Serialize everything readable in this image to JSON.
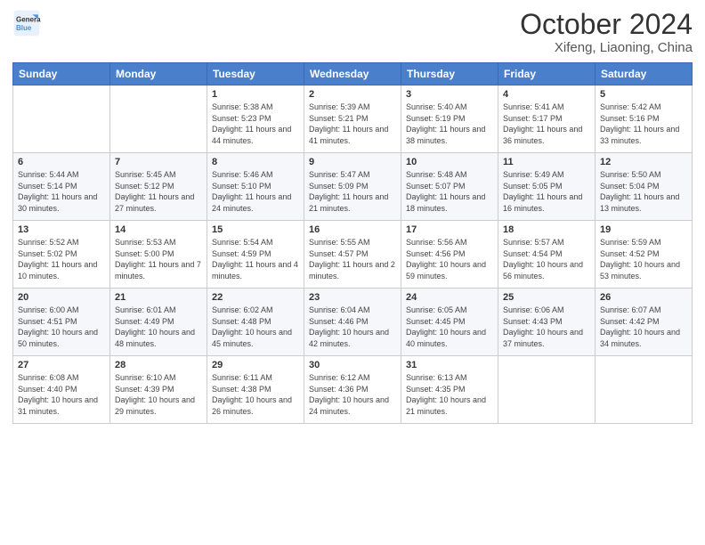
{
  "logo": {
    "line1": "General",
    "line2": "Blue"
  },
  "title": "October 2024",
  "subtitle": "Xifeng, Liaoning, China",
  "days_of_week": [
    "Sunday",
    "Monday",
    "Tuesday",
    "Wednesday",
    "Thursday",
    "Friday",
    "Saturday"
  ],
  "weeks": [
    [
      {
        "day": "",
        "sunrise": "",
        "sunset": "",
        "daylight": ""
      },
      {
        "day": "",
        "sunrise": "",
        "sunset": "",
        "daylight": ""
      },
      {
        "day": "1",
        "sunrise": "Sunrise: 5:38 AM",
        "sunset": "Sunset: 5:23 PM",
        "daylight": "Daylight: 11 hours and 44 minutes."
      },
      {
        "day": "2",
        "sunrise": "Sunrise: 5:39 AM",
        "sunset": "Sunset: 5:21 PM",
        "daylight": "Daylight: 11 hours and 41 minutes."
      },
      {
        "day": "3",
        "sunrise": "Sunrise: 5:40 AM",
        "sunset": "Sunset: 5:19 PM",
        "daylight": "Daylight: 11 hours and 38 minutes."
      },
      {
        "day": "4",
        "sunrise": "Sunrise: 5:41 AM",
        "sunset": "Sunset: 5:17 PM",
        "daylight": "Daylight: 11 hours and 36 minutes."
      },
      {
        "day": "5",
        "sunrise": "Sunrise: 5:42 AM",
        "sunset": "Sunset: 5:16 PM",
        "daylight": "Daylight: 11 hours and 33 minutes."
      }
    ],
    [
      {
        "day": "6",
        "sunrise": "Sunrise: 5:44 AM",
        "sunset": "Sunset: 5:14 PM",
        "daylight": "Daylight: 11 hours and 30 minutes."
      },
      {
        "day": "7",
        "sunrise": "Sunrise: 5:45 AM",
        "sunset": "Sunset: 5:12 PM",
        "daylight": "Daylight: 11 hours and 27 minutes."
      },
      {
        "day": "8",
        "sunrise": "Sunrise: 5:46 AM",
        "sunset": "Sunset: 5:10 PM",
        "daylight": "Daylight: 11 hours and 24 minutes."
      },
      {
        "day": "9",
        "sunrise": "Sunrise: 5:47 AM",
        "sunset": "Sunset: 5:09 PM",
        "daylight": "Daylight: 11 hours and 21 minutes."
      },
      {
        "day": "10",
        "sunrise": "Sunrise: 5:48 AM",
        "sunset": "Sunset: 5:07 PM",
        "daylight": "Daylight: 11 hours and 18 minutes."
      },
      {
        "day": "11",
        "sunrise": "Sunrise: 5:49 AM",
        "sunset": "Sunset: 5:05 PM",
        "daylight": "Daylight: 11 hours and 16 minutes."
      },
      {
        "day": "12",
        "sunrise": "Sunrise: 5:50 AM",
        "sunset": "Sunset: 5:04 PM",
        "daylight": "Daylight: 11 hours and 13 minutes."
      }
    ],
    [
      {
        "day": "13",
        "sunrise": "Sunrise: 5:52 AM",
        "sunset": "Sunset: 5:02 PM",
        "daylight": "Daylight: 11 hours and 10 minutes."
      },
      {
        "day": "14",
        "sunrise": "Sunrise: 5:53 AM",
        "sunset": "Sunset: 5:00 PM",
        "daylight": "Daylight: 11 hours and 7 minutes."
      },
      {
        "day": "15",
        "sunrise": "Sunrise: 5:54 AM",
        "sunset": "Sunset: 4:59 PM",
        "daylight": "Daylight: 11 hours and 4 minutes."
      },
      {
        "day": "16",
        "sunrise": "Sunrise: 5:55 AM",
        "sunset": "Sunset: 4:57 PM",
        "daylight": "Daylight: 11 hours and 2 minutes."
      },
      {
        "day": "17",
        "sunrise": "Sunrise: 5:56 AM",
        "sunset": "Sunset: 4:56 PM",
        "daylight": "Daylight: 10 hours and 59 minutes."
      },
      {
        "day": "18",
        "sunrise": "Sunrise: 5:57 AM",
        "sunset": "Sunset: 4:54 PM",
        "daylight": "Daylight: 10 hours and 56 minutes."
      },
      {
        "day": "19",
        "sunrise": "Sunrise: 5:59 AM",
        "sunset": "Sunset: 4:52 PM",
        "daylight": "Daylight: 10 hours and 53 minutes."
      }
    ],
    [
      {
        "day": "20",
        "sunrise": "Sunrise: 6:00 AM",
        "sunset": "Sunset: 4:51 PM",
        "daylight": "Daylight: 10 hours and 50 minutes."
      },
      {
        "day": "21",
        "sunrise": "Sunrise: 6:01 AM",
        "sunset": "Sunset: 4:49 PM",
        "daylight": "Daylight: 10 hours and 48 minutes."
      },
      {
        "day": "22",
        "sunrise": "Sunrise: 6:02 AM",
        "sunset": "Sunset: 4:48 PM",
        "daylight": "Daylight: 10 hours and 45 minutes."
      },
      {
        "day": "23",
        "sunrise": "Sunrise: 6:04 AM",
        "sunset": "Sunset: 4:46 PM",
        "daylight": "Daylight: 10 hours and 42 minutes."
      },
      {
        "day": "24",
        "sunrise": "Sunrise: 6:05 AM",
        "sunset": "Sunset: 4:45 PM",
        "daylight": "Daylight: 10 hours and 40 minutes."
      },
      {
        "day": "25",
        "sunrise": "Sunrise: 6:06 AM",
        "sunset": "Sunset: 4:43 PM",
        "daylight": "Daylight: 10 hours and 37 minutes."
      },
      {
        "day": "26",
        "sunrise": "Sunrise: 6:07 AM",
        "sunset": "Sunset: 4:42 PM",
        "daylight": "Daylight: 10 hours and 34 minutes."
      }
    ],
    [
      {
        "day": "27",
        "sunrise": "Sunrise: 6:08 AM",
        "sunset": "Sunset: 4:40 PM",
        "daylight": "Daylight: 10 hours and 31 minutes."
      },
      {
        "day": "28",
        "sunrise": "Sunrise: 6:10 AM",
        "sunset": "Sunset: 4:39 PM",
        "daylight": "Daylight: 10 hours and 29 minutes."
      },
      {
        "day": "29",
        "sunrise": "Sunrise: 6:11 AM",
        "sunset": "Sunset: 4:38 PM",
        "daylight": "Daylight: 10 hours and 26 minutes."
      },
      {
        "day": "30",
        "sunrise": "Sunrise: 6:12 AM",
        "sunset": "Sunset: 4:36 PM",
        "daylight": "Daylight: 10 hours and 24 minutes."
      },
      {
        "day": "31",
        "sunrise": "Sunrise: 6:13 AM",
        "sunset": "Sunset: 4:35 PM",
        "daylight": "Daylight: 10 hours and 21 minutes."
      },
      {
        "day": "",
        "sunrise": "",
        "sunset": "",
        "daylight": ""
      },
      {
        "day": "",
        "sunrise": "",
        "sunset": "",
        "daylight": ""
      }
    ]
  ]
}
